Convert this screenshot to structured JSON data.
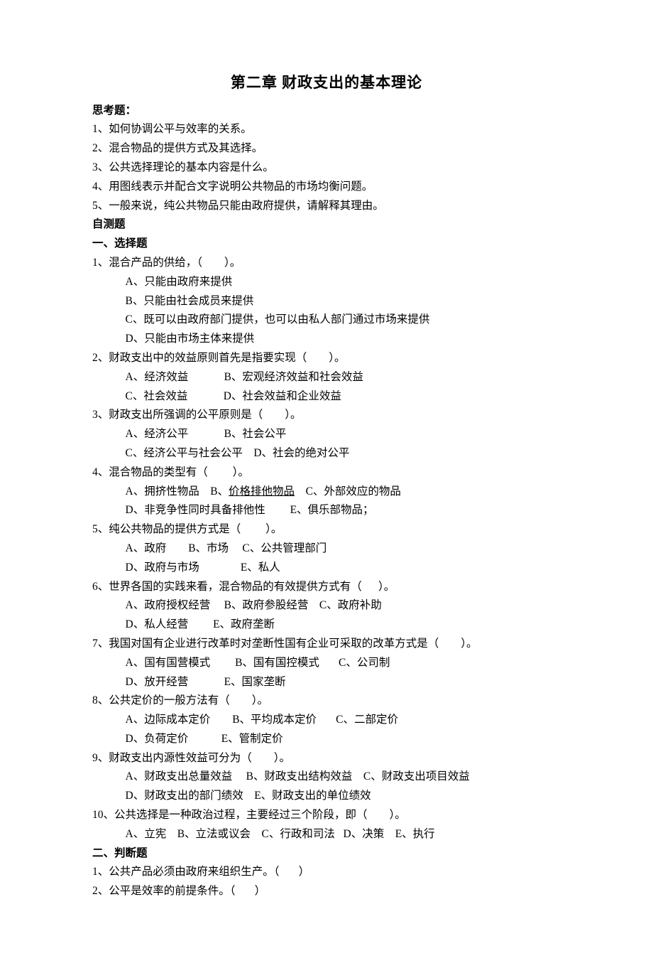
{
  "title": "第二章   财政支出的基本理论",
  "thinkHeader": "思考题：",
  "think": [
    "1、如何协调公平与效率的关系。",
    "2、混合物品的提供方式及其选择。",
    "3、公共选择理论的基本内容是什么。",
    "4、用图线表示并配合文字说明公共物品的市场均衡问题。",
    "5、一般来说，纯公共物品只能由政府提供，请解释其理由。"
  ],
  "selfTestHeader": "自测题",
  "section1Header": "一、选择题",
  "q1": {
    "stem": "1、混合产品的供给，（        ）。",
    "a": "A、只能由政府来提供",
    "b": "B、只能由社会成员来提供",
    "c": "C、既可以由政府部门提供，也可以由私人部门通过市场来提供",
    "d": "D、只能由市场主体来提供"
  },
  "q2": {
    "stem": "2、财政支出中的效益原则首先是指要实现（        ）。",
    "row1": "A、经济效益             B、宏观经济效益和社会效益",
    "row2": "C、社会效益             D、社会效益和企业效益"
  },
  "q3": {
    "stem": "3、财政支出所强调的公平原则是（        ）。",
    "row1": "A、经济公平             B、社会公平",
    "row2": "C、经济公平与社会公平    D、社会的绝对公平"
  },
  "q4": {
    "stem": "4、混合物品的类型有（         ）。",
    "row1a": "A、拥挤性物品    B、",
    "row1b": "价格排他物品",
    "row1c": "    C、外部效应的物品",
    "row2": "D、非竞争性同时具备排他性         E、俱乐部物品；"
  },
  "q5": {
    "stem": "5、纯公共物品的提供方式是（         ）。",
    "row1": "A、政府        B、市场     C、公共管理部门",
    "row2": "D、政府与市场               E、私人"
  },
  "q6": {
    "stem": "6、世界各国的实践来看，混合物品的有效提供方式有（      ）。",
    "row1": "A、政府授权经营     B、政府参股经营    C、政府补助",
    "row2": "D、私人经营         E、政府垄断"
  },
  "q7": {
    "stem": "7、我国对国有企业进行改革时对垄断性国有企业可采取的改革方式是（        ）。",
    "row1": "A、国有国营模式         B、国有国控模式       C、公司制",
    "row2": "D、放开经营             E、国家垄断"
  },
  "q8": {
    "stem": "8、公共定价的一般方法有（        ）。",
    "row1": "A、边际成本定价        B、平均成本定价       C、二部定价",
    "row2": "D、负荷定价            E、管制定价"
  },
  "q9": {
    "stem": "9、财政支出内源性效益可分为（        ）。",
    "row1": "A、财政支出总量效益     B、财政支出结构效益    C、财政支出项目效益",
    "row2": "D、财政支出的部门绩效    E、财政支出的单位绩效"
  },
  "q10": {
    "stem": "10、公共选择是一种政治过程，主要经过三个阶段，即（        ）。",
    "row1": "A、立宪    B、立法或议会    C、行政和司法   D、决策    E、执行"
  },
  "section2Header": "二、判断题",
  "judge": [
    "1、公共产品必须由政府来组织生产。（       ）",
    "2、公平是效率的前提条件。（       ）"
  ]
}
